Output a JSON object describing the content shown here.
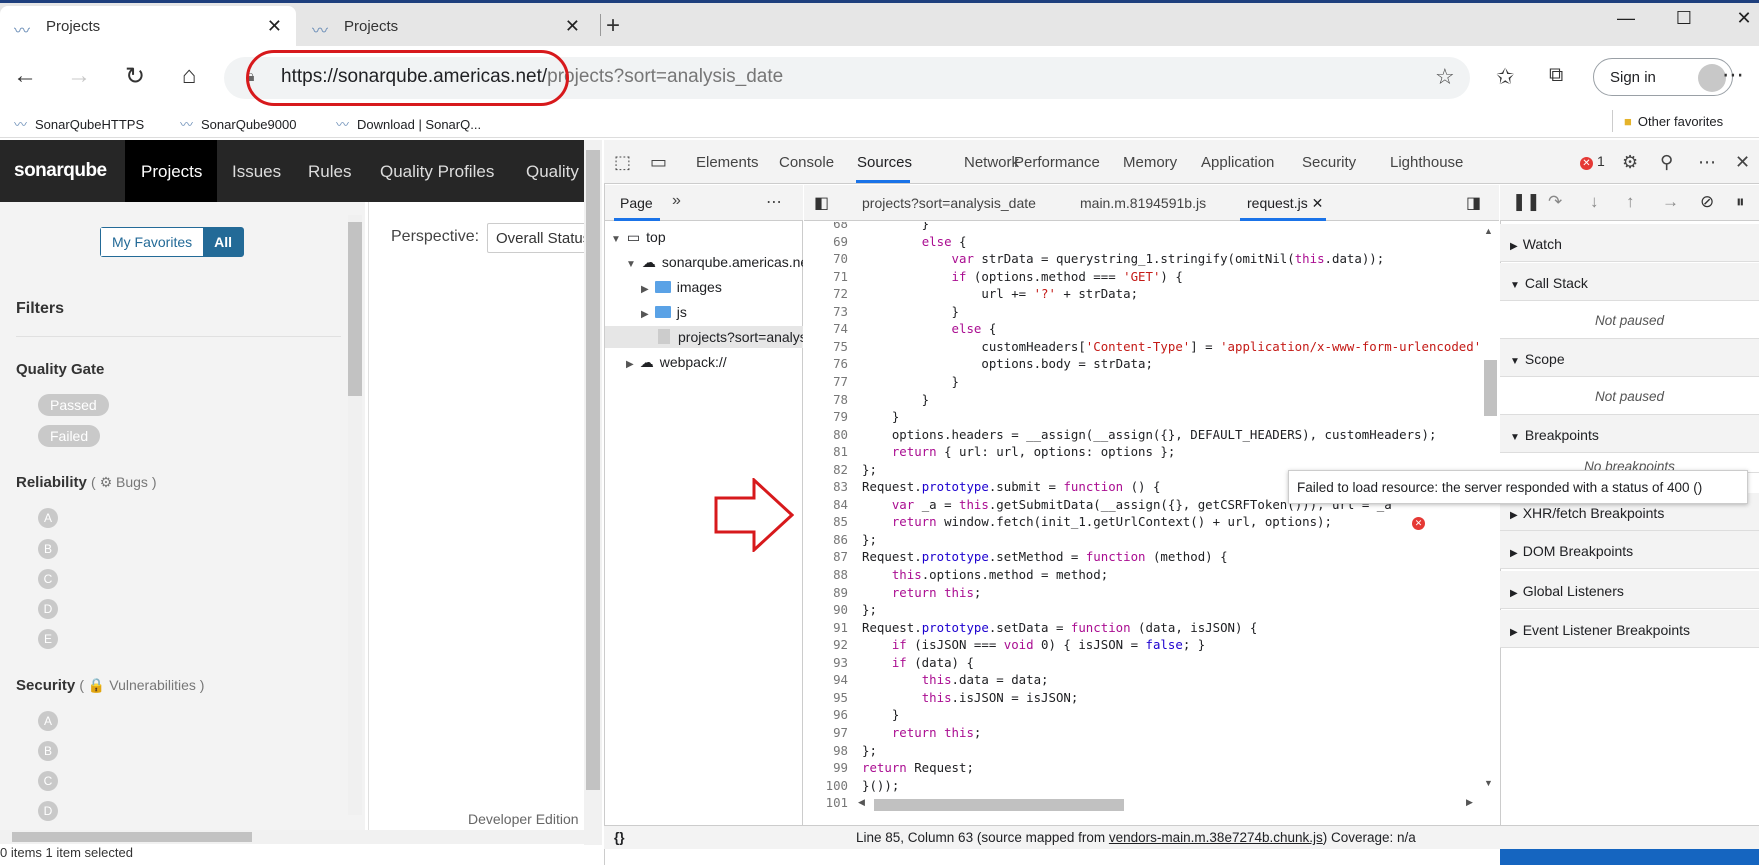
{
  "browser": {
    "tabs": [
      {
        "title": "Projects",
        "close": "✕"
      },
      {
        "title": "Projects",
        "close": "✕"
      }
    ],
    "new_tab": "+",
    "url_host": "https://sonarqube.americas.net/",
    "url_path": "projects?sort=analysis_date",
    "sign_in": "Sign in",
    "favorites": [
      "SonarQubeHTTPS",
      "SonarQube9000",
      "Download | SonarQ..."
    ],
    "other_favorites": "Other favorites"
  },
  "sonarqube": {
    "logo": "sonarqube",
    "nav": [
      "Projects",
      "Issues",
      "Rules",
      "Quality Profiles",
      "Quality"
    ],
    "my_favorites": "My Favorites",
    "all": "All",
    "filters": "Filters",
    "quality_gate": "Quality Gate",
    "gate_options": [
      "Passed",
      "Failed"
    ],
    "reliability": "Reliability",
    "reliability_sub": "( ⚙ Bugs )",
    "security": "Security",
    "security_sub": "( 🔒 Vulnerabilities )",
    "ratings": [
      "A",
      "B",
      "C",
      "D",
      "E"
    ],
    "perspective_label": "Perspective:",
    "perspective_value": "Overall Status",
    "edition": "Developer Edition",
    "status": "0 items    1 item selected"
  },
  "devtools": {
    "tabs": [
      "Elements",
      "Console",
      "Sources",
      "Network",
      "Performance",
      "Memory",
      "Application",
      "Security",
      "Lighthouse"
    ],
    "error_count": "1",
    "navigator_tab": "Page",
    "tree": {
      "top": "top",
      "host": "sonarqube.americas.net",
      "images": "images",
      "js": "js",
      "file": "projects?sort=analysis_date",
      "webpack": "webpack://"
    },
    "editor_tabs": [
      "projects?sort=analysis_date",
      "main.m.8194591b.js",
      "request.js"
    ],
    "code_lines": [
      {
        "n": "68",
        "t": "        }"
      },
      {
        "n": "69",
        "t": "        else {"
      },
      {
        "n": "70",
        "t": "            var strData = querystring_1.stringify(omitNil(this.data));"
      },
      {
        "n": "71",
        "t": "            if (options.method === 'GET') {"
      },
      {
        "n": "72",
        "t": "                url += '?' + strData;"
      },
      {
        "n": "73",
        "t": "            }"
      },
      {
        "n": "74",
        "t": "            else {"
      },
      {
        "n": "75",
        "t": "                customHeaders['Content-Type'] = 'application/x-www-form-urlencoded';"
      },
      {
        "n": "76",
        "t": "                options.body = strData;"
      },
      {
        "n": "77",
        "t": "            }"
      },
      {
        "n": "78",
        "t": "        }"
      },
      {
        "n": "79",
        "t": "    }"
      },
      {
        "n": "80",
        "t": "    options.headers = __assign(__assign({}, DEFAULT_HEADERS), customHeaders);"
      },
      {
        "n": "81",
        "t": "    return { url: url, options: options };"
      },
      {
        "n": "82",
        "t": "};"
      },
      {
        "n": "83",
        "t": "Request.prototype.submit = function () {"
      },
      {
        "n": "84",
        "t": "    var _a = this.getSubmitData(__assign({}, getCSRFToken())), url = _a"
      },
      {
        "n": "85",
        "t": "    return window.fetch(init_1.getUrlContext() + url, options);"
      },
      {
        "n": "86",
        "t": "};"
      },
      {
        "n": "87",
        "t": "Request.prototype.setMethod = function (method) {"
      },
      {
        "n": "88",
        "t": "    this.options.method = method;"
      },
      {
        "n": "89",
        "t": "    return this;"
      },
      {
        "n": "90",
        "t": "};"
      },
      {
        "n": "91",
        "t": "Request.prototype.setData = function (data, isJSON) {"
      },
      {
        "n": "92",
        "t": "    if (isJSON === void 0) { isJSON = false; }"
      },
      {
        "n": "93",
        "t": "    if (data) {"
      },
      {
        "n": "94",
        "t": "        this.data = data;"
      },
      {
        "n": "95",
        "t": "        this.isJSON = isJSON;"
      },
      {
        "n": "96",
        "t": "    }"
      },
      {
        "n": "97",
        "t": "    return this;"
      },
      {
        "n": "98",
        "t": "};"
      },
      {
        "n": "99",
        "t": "return Request;"
      },
      {
        "n": "100",
        "t": "}());"
      },
      {
        "n": "101",
        "t": ""
      }
    ],
    "tooltip": "Failed to load resource: the server responded with a status of 400 ()",
    "status_prefix": "Line 85, Column 63  (source mapped from ",
    "status_link": "vendors-main.m.38e7274b.chunk.js",
    "status_suffix": ")  Coverage: n/a",
    "sidebar": {
      "watch": "Watch",
      "call_stack": "Call Stack",
      "not_paused_1": "Not paused",
      "scope": "Scope",
      "not_paused_2": "Not paused",
      "breakpoints": "Breakpoints",
      "no_breakpoints": "No breakpoints",
      "xhr": "XHR/fetch Breakpoints",
      "dom": "DOM Breakpoints",
      "global": "Global Listeners",
      "event": "Event Listener Breakpoints"
    }
  }
}
